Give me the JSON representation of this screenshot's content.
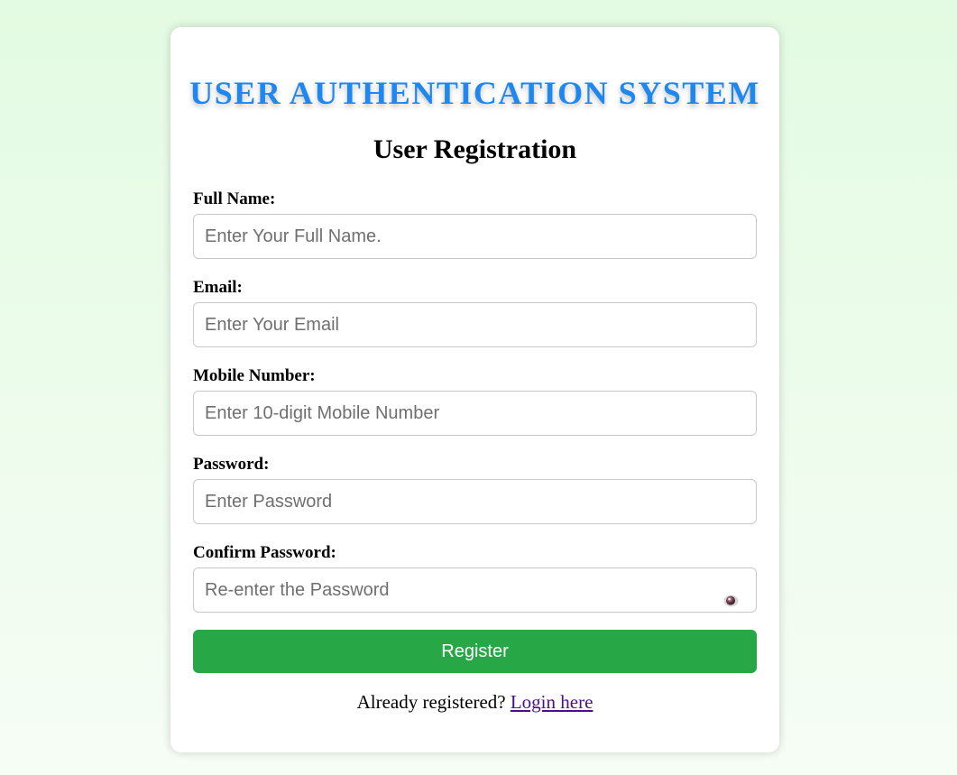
{
  "header": {
    "app_title": "USER AUTHENTICATION SYSTEM",
    "form_title": "User Registration"
  },
  "fields": [
    {
      "label": "Full Name:",
      "placeholder": "Enter Your Full Name.",
      "value": ""
    },
    {
      "label": "Email:",
      "placeholder": "Enter Your Email",
      "value": ""
    },
    {
      "label": "Mobile Number:",
      "placeholder": "Enter 10-digit Mobile Number",
      "value": ""
    },
    {
      "label": "Password:",
      "placeholder": "Enter Password",
      "value": ""
    },
    {
      "label": "Confirm Password:",
      "placeholder": "Re-enter the Password",
      "value": ""
    }
  ],
  "actions": {
    "register_label": "Register"
  },
  "footer": {
    "prompt": "Already registered?",
    "link_label": "Login here"
  },
  "icons": {
    "password_toggle": "eye-icon"
  },
  "colors": {
    "title_accent": "#1e88f0",
    "button_bg": "#27a745",
    "link": "#4b0f8a"
  }
}
